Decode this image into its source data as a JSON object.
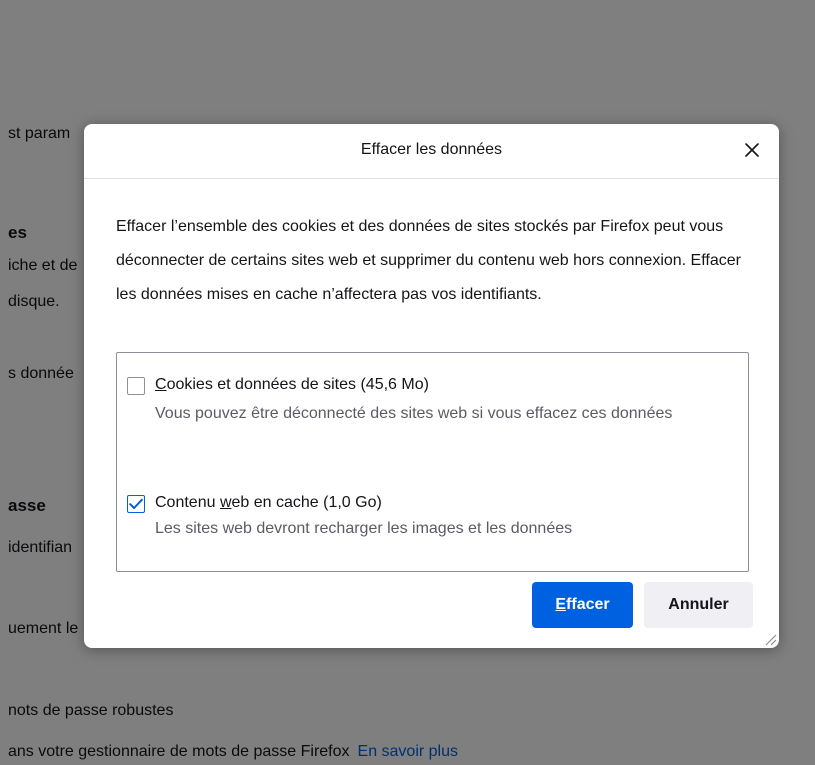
{
  "background": {
    "lines": [
      {
        "text": "st param",
        "bold": false
      },
      {
        "text": "es",
        "bold": true
      },
      {
        "text": "iche et de",
        "bold": false
      },
      {
        "text": "disque.",
        "bold": false
      },
      {
        "text": "s donnée",
        "bold": false
      },
      {
        "text": "asse",
        "bold": true
      },
      {
        "text": "identifian",
        "bold": false
      },
      {
        "text": "uement le",
        "bold": false
      },
      {
        "text": "nots de passe robustes",
        "bold": false
      },
      {
        "text": "ans votre gestionnaire de mots de passe Firefox",
        "bold": false
      }
    ],
    "link": "En savoir plus"
  },
  "dialog": {
    "title": "Effacer les données",
    "description": "Effacer l’ensemble des cookies et des données de sites stockés par Firefox peut vous déconnecter de certains sites web et supprimer du contenu web hors connexion. Effacer les données mises en cache n’affectera pas vos identifiants.",
    "options": [
      {
        "label_accesskey": "C",
        "label_rest": "ookies et données de sites (45,6 Mo)",
        "description": "Vous pouvez être déconnecté des sites web si vous effacez ces données",
        "checked": false
      },
      {
        "label_pre": "Contenu ",
        "label_accesskey": "w",
        "label_rest": "eb en cache (1,0 Go)",
        "description": "Les sites web devront recharger les images et les données",
        "checked": true
      }
    ],
    "buttons": {
      "primary_accesskey": "E",
      "primary_rest": "ffacer",
      "secondary": "Annuler"
    },
    "colors": {
      "accent": "#0061e0",
      "overlay": "#000000",
      "secondary_button": "#f0f0f4"
    }
  }
}
